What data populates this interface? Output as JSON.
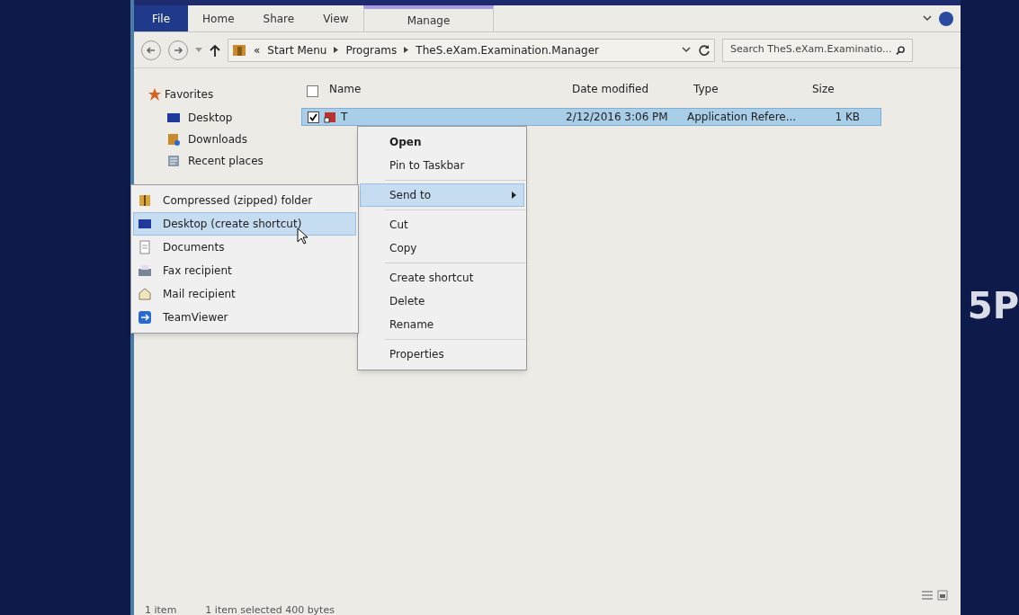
{
  "ribbon": {
    "tabs": [
      {
        "label": "File",
        "kind": "file"
      },
      {
        "label": "Home",
        "kind": "tab"
      },
      {
        "label": "Share",
        "kind": "tab"
      },
      {
        "label": "View",
        "kind": "tab"
      },
      {
        "label": "Manage",
        "kind": "contextual"
      }
    ]
  },
  "address_bar": {
    "prefix": "«",
    "breadcrumb": [
      "Start Menu",
      "Programs",
      "TheS.eXam.Examination.Manager"
    ],
    "search": {
      "placeholder": "Search TheS.eXam.Examinatio..."
    }
  },
  "sidebar": {
    "heading": "Favorites",
    "items": [
      {
        "label": "Desktop",
        "kind": "desktop"
      },
      {
        "label": "Downloads",
        "kind": "downloads"
      },
      {
        "label": "Recent places",
        "kind": "recent"
      }
    ]
  },
  "table": {
    "select_all_checked": false,
    "columns": [
      "Name",
      "Date modified",
      "Type",
      "Size"
    ],
    "rows": [
      {
        "name": "T",
        "date": "2/12/2016 3:06 PM",
        "type": "Application Refere...",
        "size": "1 KB",
        "selected": true,
        "checked": true
      }
    ]
  },
  "context_menu": {
    "groups": [
      [
        {
          "label": "Open",
          "default": true,
          "selected": false,
          "submenu": false
        },
        {
          "label": "Pin to Taskbar",
          "default": false,
          "selected": false,
          "submenu": false
        }
      ],
      [
        {
          "label": "Send to",
          "default": false,
          "selected": true,
          "submenu": true
        }
      ],
      [
        {
          "label": "Cut",
          "default": false,
          "selected": false,
          "submenu": false
        },
        {
          "label": "Copy",
          "default": false,
          "selected": false,
          "submenu": false
        }
      ],
      [
        {
          "label": "Create shortcut",
          "default": false,
          "selected": false,
          "submenu": false
        },
        {
          "label": "Delete",
          "default": false,
          "selected": false,
          "submenu": false
        },
        {
          "label": "Rename",
          "default": false,
          "selected": false,
          "submenu": false
        }
      ],
      [
        {
          "label": "Properties",
          "default": false,
          "selected": false,
          "submenu": false
        }
      ]
    ]
  },
  "send_to_menu": {
    "items": [
      {
        "label": "Compressed (zipped) folder",
        "kind": "zip",
        "selected": false
      },
      {
        "label": "Desktop (create shortcut)",
        "kind": "desktop",
        "selected": true
      },
      {
        "label": "Documents",
        "kind": "documents",
        "selected": false
      },
      {
        "label": "Fax recipient",
        "kind": "fax",
        "selected": false
      },
      {
        "label": "Mail recipient",
        "kind": "mail",
        "selected": false
      },
      {
        "label": "TeamViewer",
        "kind": "teamviewer",
        "selected": false
      }
    ]
  },
  "status_bar": [
    "1 item",
    "1 item selected 400 bytes"
  ],
  "desktop_text": "5P"
}
